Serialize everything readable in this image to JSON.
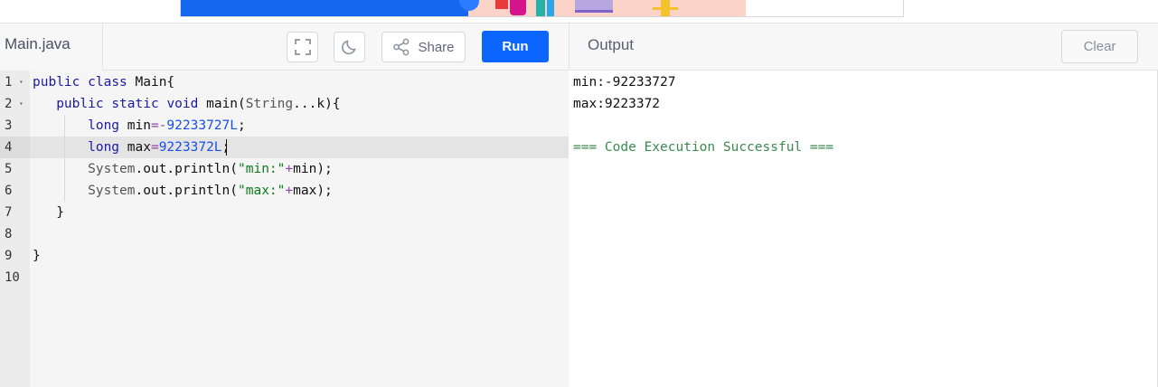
{
  "header": {
    "file_tab": "Main.java",
    "share_label": "Share",
    "run_label": "Run",
    "output_title": "Output",
    "clear_label": "Clear",
    "icons": [
      "fullscreen-icon",
      "dark-mode-icon",
      "share-icon"
    ]
  },
  "editor": {
    "active_line": 4,
    "lines": [
      {
        "n": "1",
        "fold": true,
        "text": "public class Main{"
      },
      {
        "n": "2",
        "fold": true,
        "text": "   public static void main(String...k){"
      },
      {
        "n": "3",
        "fold": false,
        "text": "       long min=-92233727L;"
      },
      {
        "n": "4",
        "fold": false,
        "text": "       long max=9223372L;"
      },
      {
        "n": "5",
        "fold": false,
        "text": "       System.out.println(\"min:\"+min);"
      },
      {
        "n": "6",
        "fold": false,
        "text": "       System.out.println(\"max:\"+max);"
      },
      {
        "n": "7",
        "fold": false,
        "text": "   }"
      },
      {
        "n": "8",
        "fold": false,
        "text": ""
      },
      {
        "n": "9",
        "fold": false,
        "text": "}"
      },
      {
        "n": "10",
        "fold": false,
        "text": ""
      }
    ]
  },
  "output": {
    "lines": [
      "min:-92233727",
      "max:9223372",
      "",
      "=== Code Execution Successful ==="
    ]
  },
  "colors": {
    "run_button": "#0a66ff",
    "keyword": "#1a1aa6",
    "string": "#0c7a1a",
    "number": "#1750eb",
    "success": "#3b8a4d"
  }
}
